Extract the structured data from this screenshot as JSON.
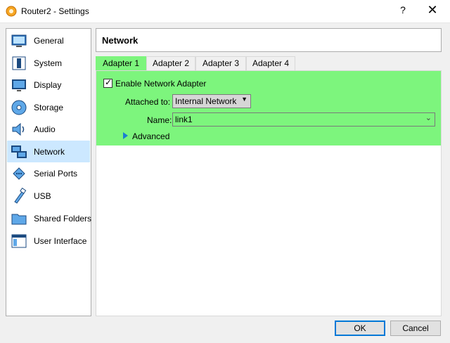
{
  "window": {
    "title": "Router2 - Settings",
    "help_icon": "?",
    "close_icon": "✕"
  },
  "sidebar": {
    "items": [
      {
        "label": "General",
        "icon": "general-icon"
      },
      {
        "label": "System",
        "icon": "system-icon"
      },
      {
        "label": "Display",
        "icon": "display-icon"
      },
      {
        "label": "Storage",
        "icon": "storage-icon"
      },
      {
        "label": "Audio",
        "icon": "audio-icon"
      },
      {
        "label": "Network",
        "icon": "network-icon",
        "selected": true
      },
      {
        "label": "Serial Ports",
        "icon": "serial-ports-icon"
      },
      {
        "label": "USB",
        "icon": "usb-icon"
      },
      {
        "label": "Shared Folders",
        "icon": "shared-folders-icon"
      },
      {
        "label": "User Interface",
        "icon": "user-interface-icon"
      }
    ]
  },
  "main": {
    "title": "Network",
    "tabs": [
      {
        "label": "Adapter 1",
        "active": true
      },
      {
        "label": "Adapter 2"
      },
      {
        "label": "Adapter 3"
      },
      {
        "label": "Adapter 4"
      }
    ],
    "enable_adapter": {
      "label": "Enable Network Adapter",
      "checked": true
    },
    "attached_to": {
      "label": "Attached to:",
      "value": "Internal Network"
    },
    "name": {
      "label": "Name:",
      "value": "link1"
    },
    "advanced": {
      "label": "Advanced"
    }
  },
  "buttons": {
    "ok": "OK",
    "cancel": "Cancel"
  },
  "colors": {
    "highlight": "#7df57d",
    "selection": "#cce8ff",
    "accent": "#0078d7"
  }
}
